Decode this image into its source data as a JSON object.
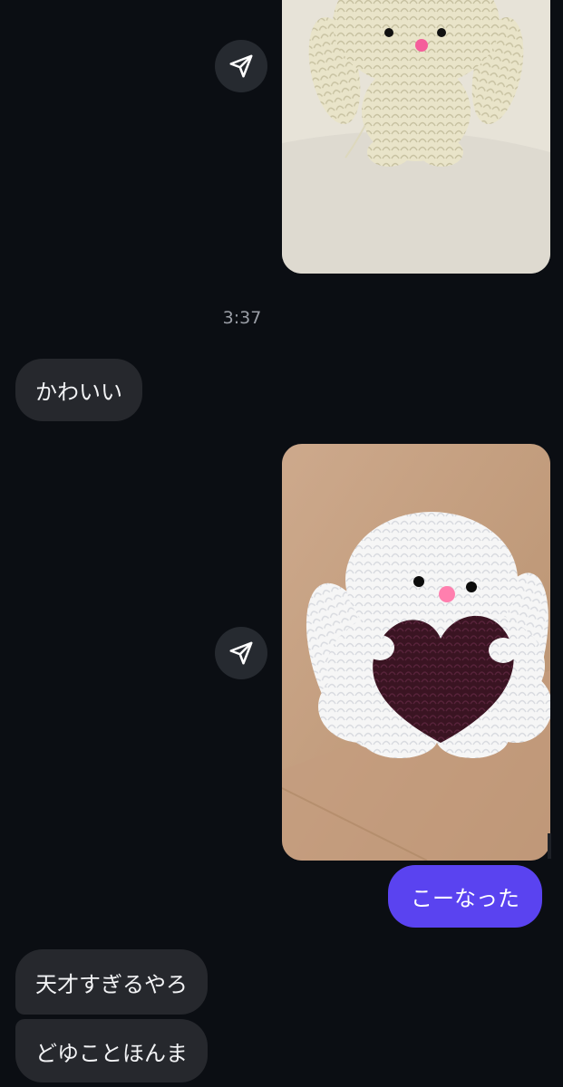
{
  "conversation": {
    "timestamp": "3:37",
    "messages": [
      {
        "from": "them",
        "text": "かわいい"
      },
      {
        "from": "me",
        "text": "こーなった"
      },
      {
        "from": "them",
        "text": "天才すぎるやろ"
      },
      {
        "from": "them",
        "text": "どゆことほんま"
      }
    ]
  },
  "photos": [
    {
      "subject": "white crochet bunny (top, partially visible)"
    },
    {
      "subject": "white crochet bunny holding dark purple heart"
    }
  ],
  "icons": {
    "share": "send-paper-plane-icon"
  },
  "colors": {
    "background": "#0b0e13",
    "incoming_bubble": "#26282d",
    "outgoing_bubble": "#5a43f0",
    "share_button": "#262a30",
    "timestamp": "#9a9ea6"
  }
}
